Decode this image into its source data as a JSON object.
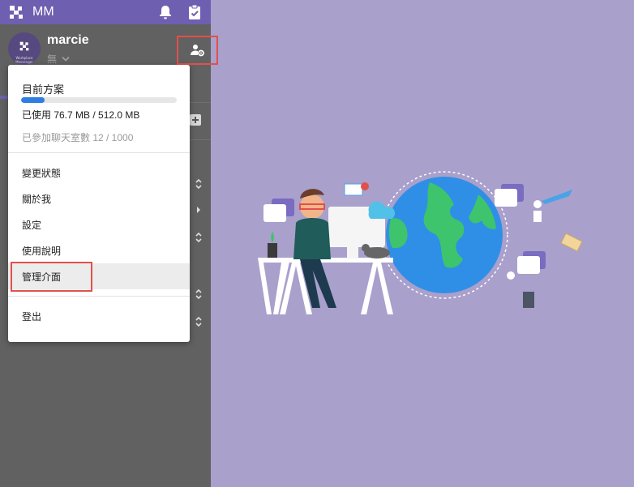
{
  "app": {
    "name": "MM"
  },
  "profile": {
    "username": "marcie",
    "status": "無",
    "avatar_text": "Workplace Messenger"
  },
  "menu": {
    "plan_title": "目前方案",
    "storage_used_fraction": 0.15,
    "usage_text": "已使用 76.7 MB / 512.0 MB",
    "rooms_text": "已參加聊天室數 12 / 1000",
    "items": [
      {
        "label": "變更狀態"
      },
      {
        "label": "關於我"
      },
      {
        "label": "設定"
      },
      {
        "label": "使用說明"
      },
      {
        "label": "管理介面"
      },
      {
        "label": "登出"
      }
    ]
  },
  "colors": {
    "topbar": "#6f5fb0",
    "sidebar": "#616161",
    "background": "#a9a0cc",
    "highlight_box": "#e2504c",
    "quota_fill": "#2f7de1"
  },
  "icons": {
    "logo": "app-logo-icon",
    "bell": "bell-icon",
    "tasks": "clipboard-check-icon",
    "profile_settings": "user-gear-icon"
  }
}
